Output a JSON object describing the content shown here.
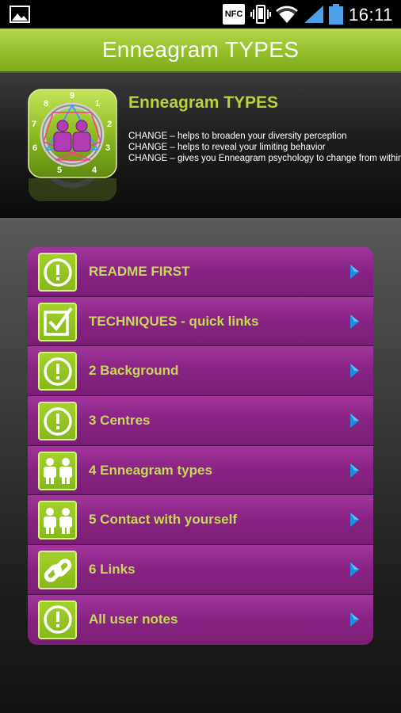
{
  "status_bar": {
    "nfc_label": "NFC",
    "time": "16:11",
    "icons": [
      "gallery-icon",
      "nfc-icon",
      "vibrate-icon",
      "wifi-icon",
      "signal-icon",
      "battery-icon"
    ]
  },
  "title_bar": {
    "title": "Enneagram TYPES"
  },
  "header": {
    "title": "Enneagram TYPES",
    "lines": [
      "CHANGE – helps to broaden your diversity perception",
      "CHANGE – helps to reveal your limiting behavior",
      "CHANGE – gives you Enneagram psychology to change from within"
    ],
    "icon_numbers": [
      "9",
      "1",
      "2",
      "3",
      "4",
      "5",
      "6",
      "7",
      "8"
    ]
  },
  "menu": {
    "items": [
      {
        "label": "README FIRST",
        "icon": "exclamation-icon"
      },
      {
        "label": "TECHNIQUES - quick links",
        "icon": "checkbox-icon"
      },
      {
        "label": "2 Background",
        "icon": "exclamation-icon"
      },
      {
        "label": "3 Centres",
        "icon": "exclamation-icon"
      },
      {
        "label": "4 Enneagram types",
        "icon": "people-icon"
      },
      {
        "label": "5 Contact with yourself",
        "icon": "people-icon"
      },
      {
        "label": "6 Links",
        "icon": "chain-link-icon"
      },
      {
        "label": "All user notes",
        "icon": "exclamation-icon"
      }
    ]
  },
  "colors": {
    "accent_green": "#95c02b",
    "menu_purple": "#8a2485",
    "label_green": "#c6d956",
    "arrow_blue": "#1a8fe0"
  }
}
